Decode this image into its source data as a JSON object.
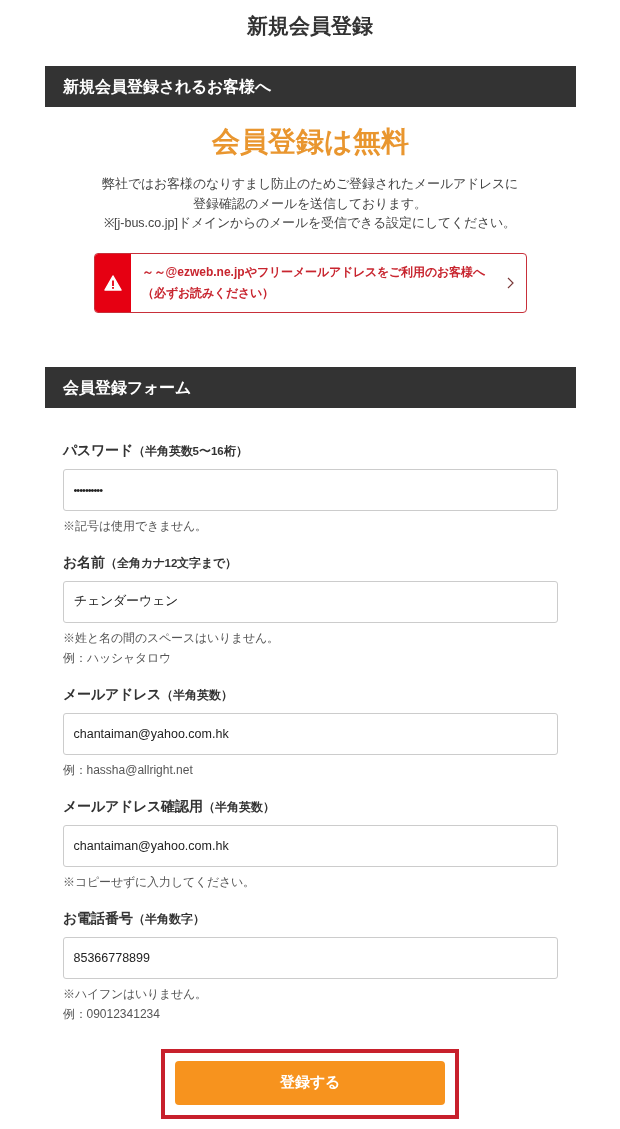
{
  "page_title": "新規会員登録",
  "intro_section": {
    "heading": "新規会員登録されるお客様へ",
    "headline": "会員登録は無料",
    "paragraphs": [
      [
        "弊社ではお客様のなりすまし防止のためご登録されたメールアドレスに",
        "登録確認のメールを送信しております。"
      ],
      [
        "※[j-bus.co.jp]ドメインからのメールを受信できる設定にしてください。"
      ]
    ],
    "notice": {
      "lines": [
        "～～@ezweb.ne.jpやフリーメールアドレスをご利用のお客様へ",
        "（必ずお読みください）"
      ]
    }
  },
  "form_section": {
    "heading": "会員登録フォーム",
    "fields": [
      {
        "label": "パスワード",
        "format": "（半角英数5〜16桁）",
        "kind": "password",
        "value": "••••••••••",
        "notes": [
          "※記号は使用できません。"
        ]
      },
      {
        "label": "お名前",
        "format": "（全角カナ12文字まで）",
        "kind": "text",
        "value": "チェンダーウェン",
        "notes": [
          "※姓と名の間のスペースはいりません。",
          "例：ハッシャタロウ"
        ]
      },
      {
        "label": "メールアドレス",
        "format": "（半角英数）",
        "kind": "text",
        "value": "chantaiman@yahoo.com.hk",
        "notes": [
          "例：hassha@allright.net"
        ]
      },
      {
        "label": "メールアドレス確認用",
        "format": "（半角英数）",
        "kind": "text",
        "value": "chantaiman@yahoo.com.hk",
        "notes": [
          "※コピーせずに入力してください。"
        ]
      },
      {
        "label": "お電話番号",
        "format": "（半角数字）",
        "kind": "text",
        "value": "85366778899",
        "notes": [
          "※ハイフンはいりません。",
          "例：09012341234"
        ]
      }
    ]
  },
  "submit": {
    "label": "登録する",
    "highlighted": true
  }
}
